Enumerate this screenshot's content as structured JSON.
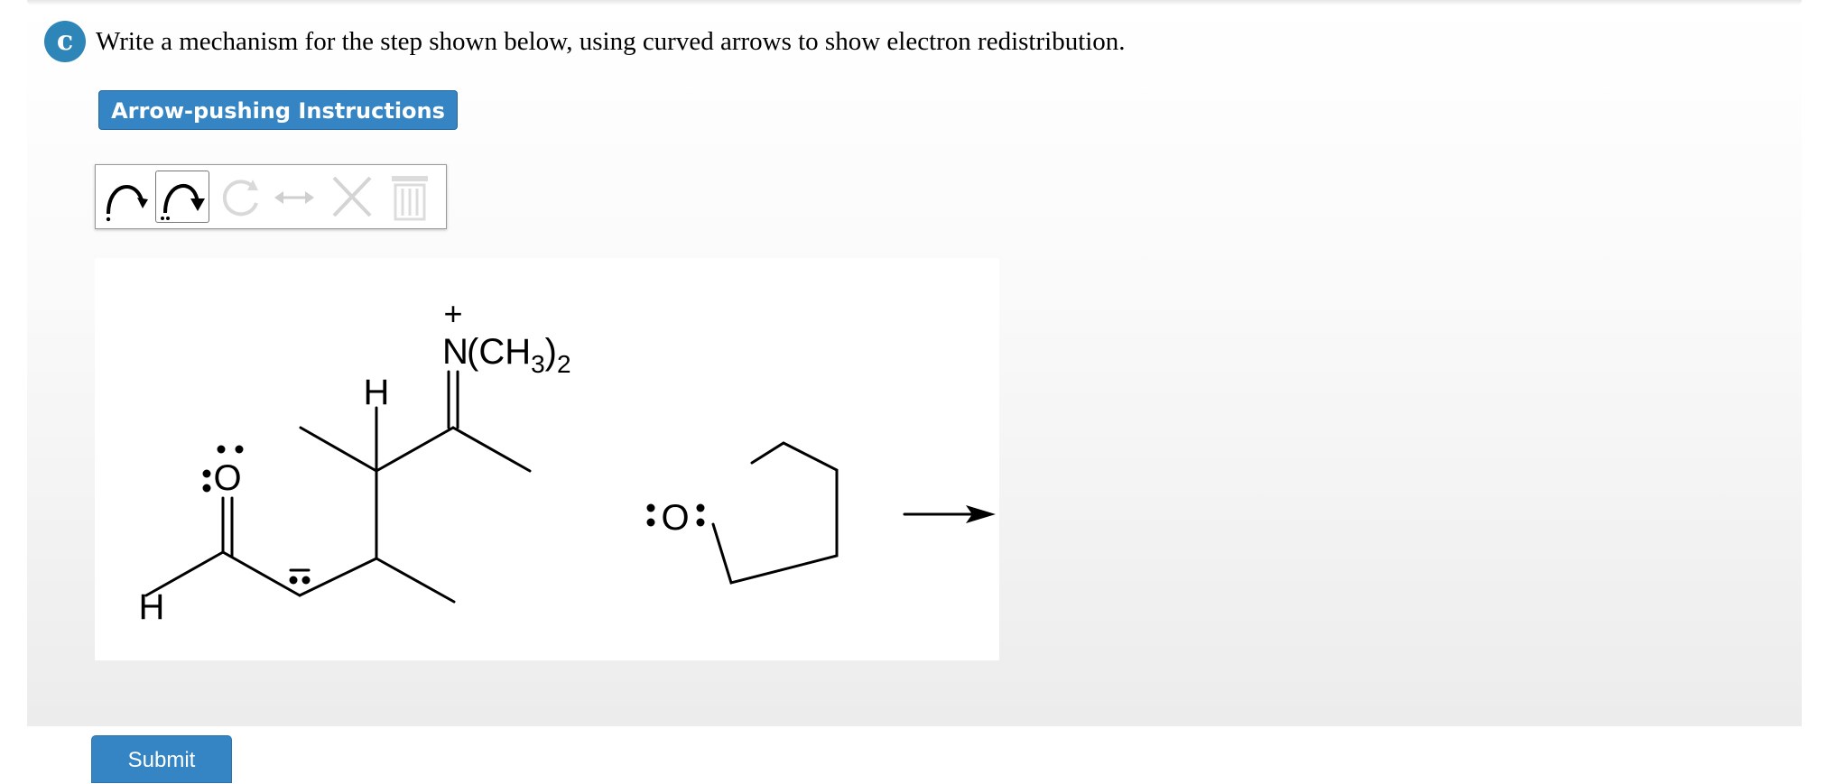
{
  "question": {
    "part_label": "c",
    "text": "Write a mechanism for the step shown below, using curved arrows to show electron redistribution."
  },
  "instructions_button": {
    "label": "Arrow-pushing Instructions"
  },
  "toolbar": {
    "tools": [
      {
        "icon": "single-electron-arrow-icon",
        "enabled": true
      },
      {
        "icon": "electron-pair-arrow-icon",
        "enabled": true,
        "selected": true
      },
      {
        "icon": "rotate-icon",
        "enabled": false
      },
      {
        "icon": "resonance-arrow-icon",
        "enabled": false
      },
      {
        "icon": "delete-x-icon",
        "enabled": false
      },
      {
        "icon": "trash-icon",
        "enabled": false
      }
    ]
  },
  "structure": {
    "plus_charge": "+",
    "amine_n": "N",
    "amine_group": "(CH",
    "amine_sub1": "3",
    "amine_close": ")",
    "amine_sub2": "2",
    "h_top": "H",
    "h_left": "H",
    "carbonyl_o": "O",
    "ether_o": "O"
  },
  "submit_button": {
    "label": "Submit"
  },
  "colors": {
    "accent": "#3585c4",
    "badge": "#2e86b8"
  }
}
